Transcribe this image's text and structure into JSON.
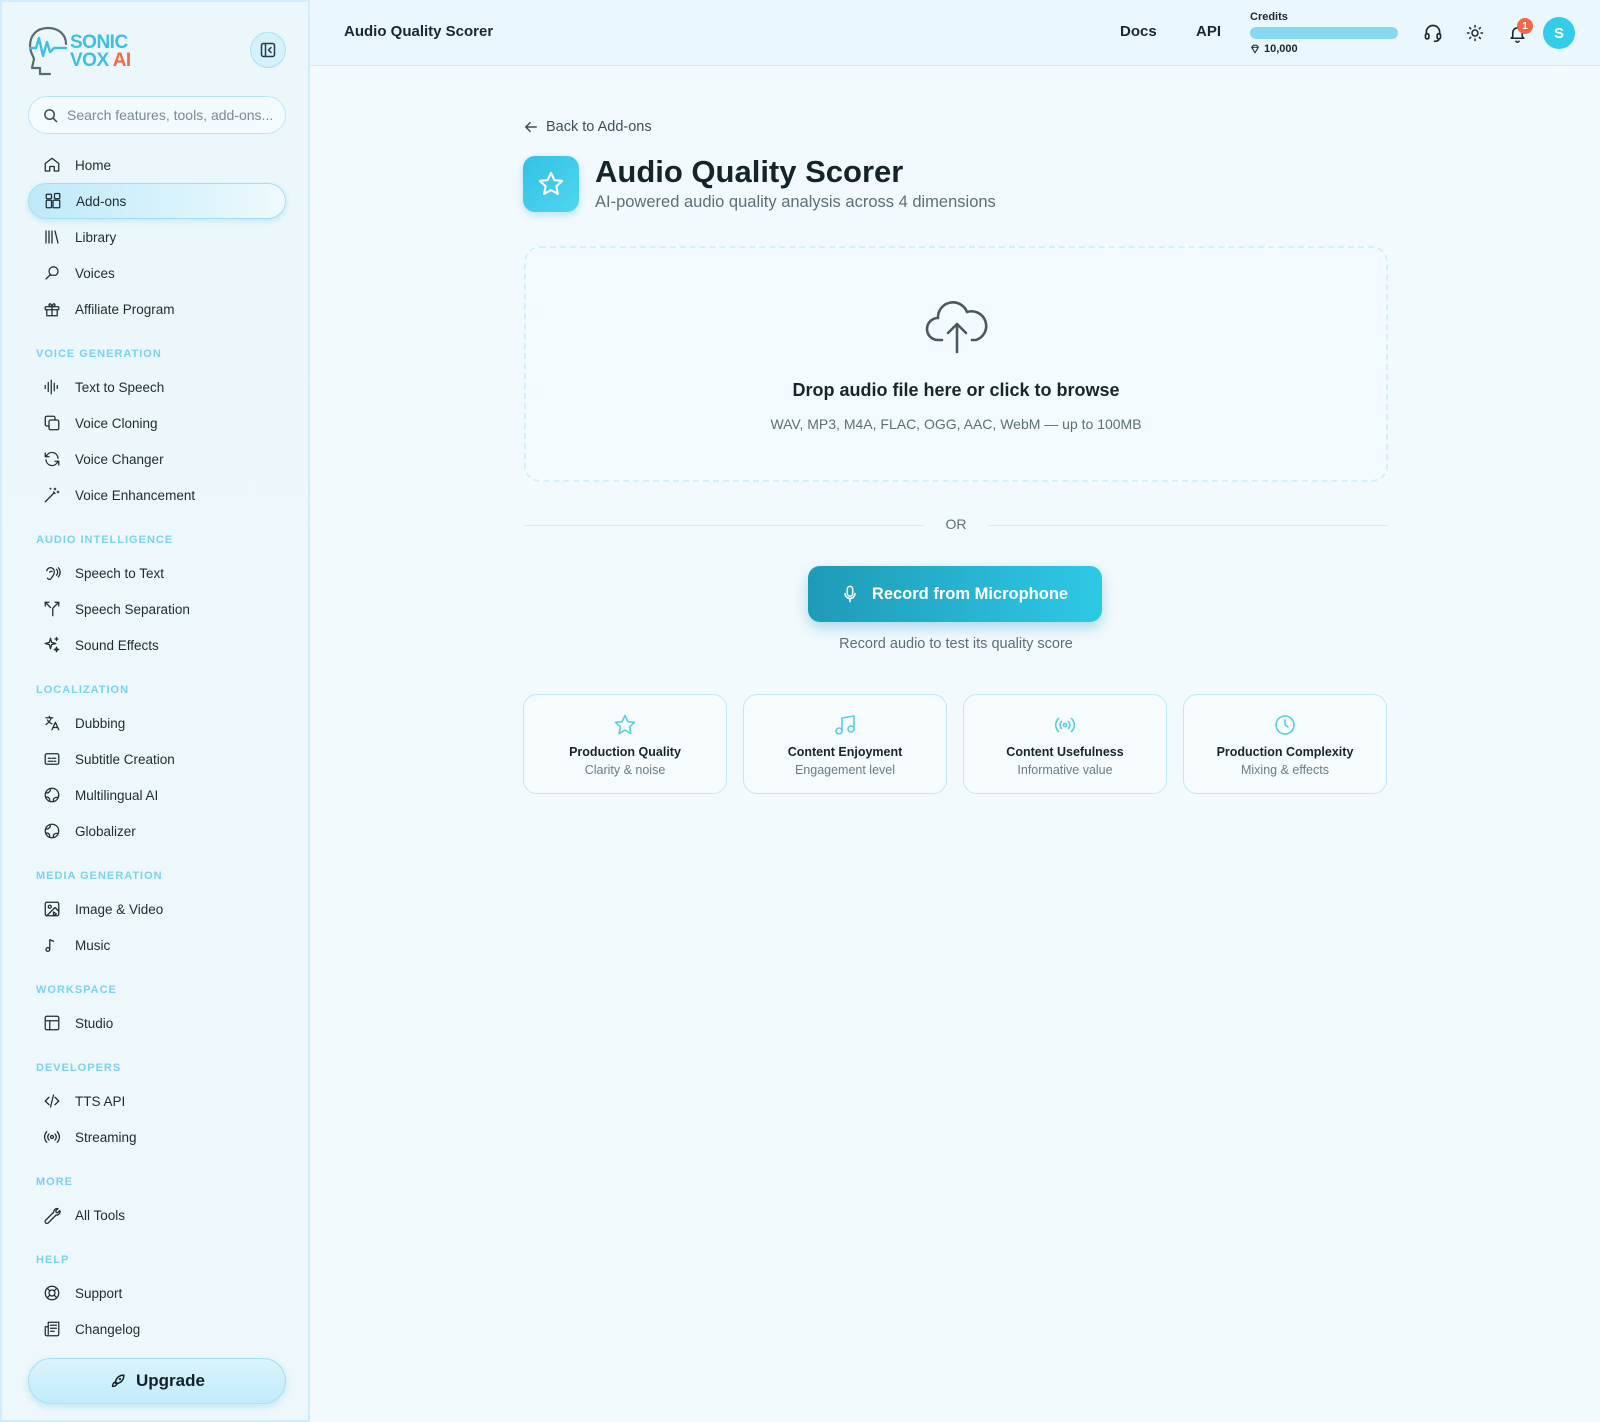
{
  "brand": {
    "line1": "SONIC",
    "line2": "VOX",
    "suffix": "AI",
    "colors": {
      "primary": "#3dbfe4",
      "accent": "#f06a4a"
    }
  },
  "search": {
    "placeholder": "Search features, tools, add-ons..."
  },
  "sidebar": {
    "top_items": [
      {
        "label": "Home",
        "icon": "home-icon"
      },
      {
        "label": "Add-ons",
        "icon": "add-ons-icon",
        "active": true
      },
      {
        "label": "Library",
        "icon": "library-icon"
      },
      {
        "label": "Voices",
        "icon": "voices-icon"
      },
      {
        "label": "Affiliate Program",
        "icon": "gift-icon"
      }
    ],
    "sections": [
      {
        "title": "VOICE GENERATION",
        "items": [
          {
            "label": "Text to Speech",
            "icon": "waveform-icon"
          },
          {
            "label": "Voice Cloning",
            "icon": "copy-icon"
          },
          {
            "label": "Voice Changer",
            "icon": "refresh-icon"
          },
          {
            "label": "Voice Enhancement",
            "icon": "wand-icon"
          }
        ]
      },
      {
        "title": "AUDIO INTELLIGENCE",
        "items": [
          {
            "label": "Speech to Text",
            "icon": "ear-icon"
          },
          {
            "label": "Speech Separation",
            "icon": "split-icon"
          },
          {
            "label": "Sound Effects",
            "icon": "sparkles-icon"
          }
        ]
      },
      {
        "title": "LOCALIZATION",
        "items": [
          {
            "label": "Dubbing",
            "icon": "translate-icon"
          },
          {
            "label": "Subtitle Creation",
            "icon": "captions-icon"
          },
          {
            "label": "Multilingual AI",
            "icon": "globe-icon"
          },
          {
            "label": "Globalizer",
            "icon": "globe-icon"
          }
        ]
      },
      {
        "title": "MEDIA GENERATION",
        "items": [
          {
            "label": "Image & Video",
            "icon": "image-icon"
          },
          {
            "label": "Music",
            "icon": "music-note-icon"
          }
        ]
      },
      {
        "title": "WORKSPACE",
        "items": [
          {
            "label": "Studio",
            "icon": "layout-icon"
          }
        ]
      },
      {
        "title": "DEVELOPERS",
        "items": [
          {
            "label": "TTS API",
            "icon": "code-icon"
          },
          {
            "label": "Streaming",
            "icon": "radio-icon"
          }
        ]
      },
      {
        "title": "MORE",
        "items": [
          {
            "label": "All Tools",
            "icon": "wrench-icon"
          }
        ]
      },
      {
        "title": "HELP",
        "items": [
          {
            "label": "Support",
            "icon": "lifebuoy-icon"
          },
          {
            "label": "Changelog",
            "icon": "newspaper-icon"
          }
        ]
      }
    ],
    "upgrade_label": "Upgrade"
  },
  "topbar": {
    "title": "Audio Quality Scorer",
    "docs": "Docs",
    "api": "API",
    "credits_label": "Credits",
    "credits_value": "10,000",
    "credits_fill_fraction": 1.0,
    "notification_count": "1",
    "avatar_initial": "S"
  },
  "main": {
    "back_label": "Back to Add-ons",
    "title": "Audio Quality Scorer",
    "subtitle": "AI-powered audio quality analysis across 4 dimensions",
    "dropzone": {
      "title": "Drop audio file here or click to browse",
      "formats": "WAV, MP3, M4A, FLAC, OGG, AAC, WebM — up to 100MB"
    },
    "or_label": "OR",
    "record_label": "Record from Microphone",
    "record_hint": "Record audio to test its quality score",
    "dimensions": [
      {
        "title": "Production Quality",
        "sub": "Clarity & noise",
        "icon": "star-icon"
      },
      {
        "title": "Content Enjoyment",
        "sub": "Engagement level",
        "icon": "music-icon"
      },
      {
        "title": "Content Usefulness",
        "sub": "Informative value",
        "icon": "broadcast-icon"
      },
      {
        "title": "Production Complexity",
        "sub": "Mixing & effects",
        "icon": "clock-icon"
      }
    ]
  }
}
